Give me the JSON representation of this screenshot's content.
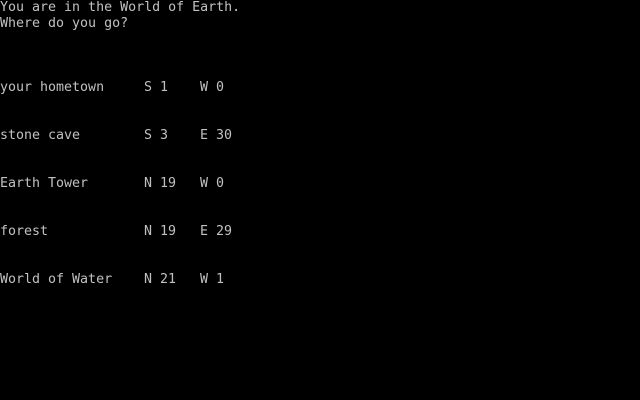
{
  "prompt": {
    "location_line": "You are in the World of Earth.",
    "question_line": "Where do you go?"
  },
  "destinations": [
    {
      "name": "your hometown",
      "coord1": "S 1",
      "coord2": "W 0"
    },
    {
      "name": "stone cave",
      "coord1": "S 3",
      "coord2": "E 30"
    },
    {
      "name": "Earth Tower",
      "coord1": "N 19",
      "coord2": "W 0"
    },
    {
      "name": "forest",
      "coord1": "N 19",
      "coord2": "E 29"
    },
    {
      "name": "World of Water",
      "coord1": "N 21",
      "coord2": "W 1"
    }
  ],
  "colors": {
    "background": "#000000",
    "text": "#c0c0c0"
  }
}
